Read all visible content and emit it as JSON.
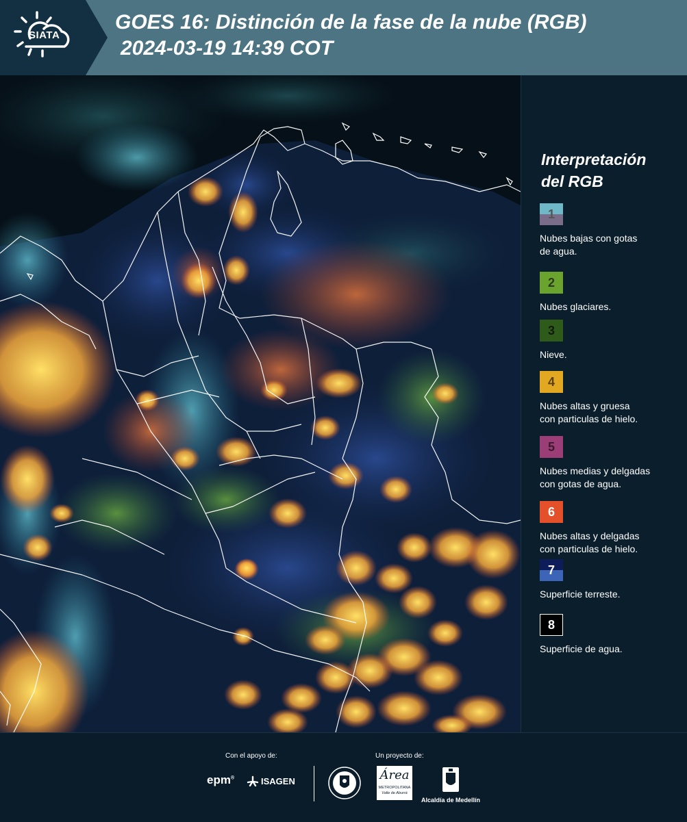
{
  "header": {
    "logo_text": "SIATA",
    "title_line1": "GOES 16: Distinción de la fase de la nube (RGB)",
    "title_line2": "2024-03-19 14:39 COT"
  },
  "legend": {
    "title_line1": "Interpretación",
    "title_line2": "del RGB",
    "items": [
      {
        "number": "1",
        "label_line1": "Nubes bajas con gotas",
        "label_line2": "de agua.",
        "color_top": "#6fb8c8",
        "color_bottom": "#7a6d8a",
        "num_color": "#555555"
      },
      {
        "number": "2",
        "label_line1": "Nubes glaciares.",
        "label_line2": "",
        "color": "#6aa42e",
        "num_color": "#2a3a1a"
      },
      {
        "number": "3",
        "label_line1": "Nieve.",
        "label_line2": "",
        "color": "#2f5b1a",
        "num_color": "#0f1a08"
      },
      {
        "number": "4",
        "label_line1": "Nubes altas y gruesa",
        "label_line2": "con particulas de hielo.",
        "color": "#e2a822",
        "num_color": "#5a4010"
      },
      {
        "number": "5",
        "label_line1": "Nubes medias y delgadas",
        "label_line2": "con gotas de agua.",
        "color": "#9b3e78",
        "num_color": "#3a1a2e"
      },
      {
        "number": "6",
        "label_line1": "Nubes altas y delgadas",
        "label_line2": "con particulas de hielo.",
        "color": "#e4502a",
        "num_color": "#ffffff"
      },
      {
        "number": "7",
        "label_line1": "Superficie terreste.",
        "label_line2": "",
        "color_top": "#0e1d5a",
        "color_bottom": "#3c65b8",
        "num_color": "#ffffff"
      },
      {
        "number": "8",
        "label_line1": "Superficie de agua.",
        "label_line2": "",
        "color": "#000000",
        "num_color": "#ffffff",
        "border": "#ffffff"
      }
    ]
  },
  "footer": {
    "support_label": "Con el apoyo de:",
    "project_label": "Un proyecto de:",
    "epm": "epm",
    "isagen": "ISAGEN",
    "area_word": "Área",
    "area_sub1": "METROPOLITANA",
    "area_sub2": "Valle de Aburrá",
    "alcaldia": "Alcaldía de Medellín"
  }
}
